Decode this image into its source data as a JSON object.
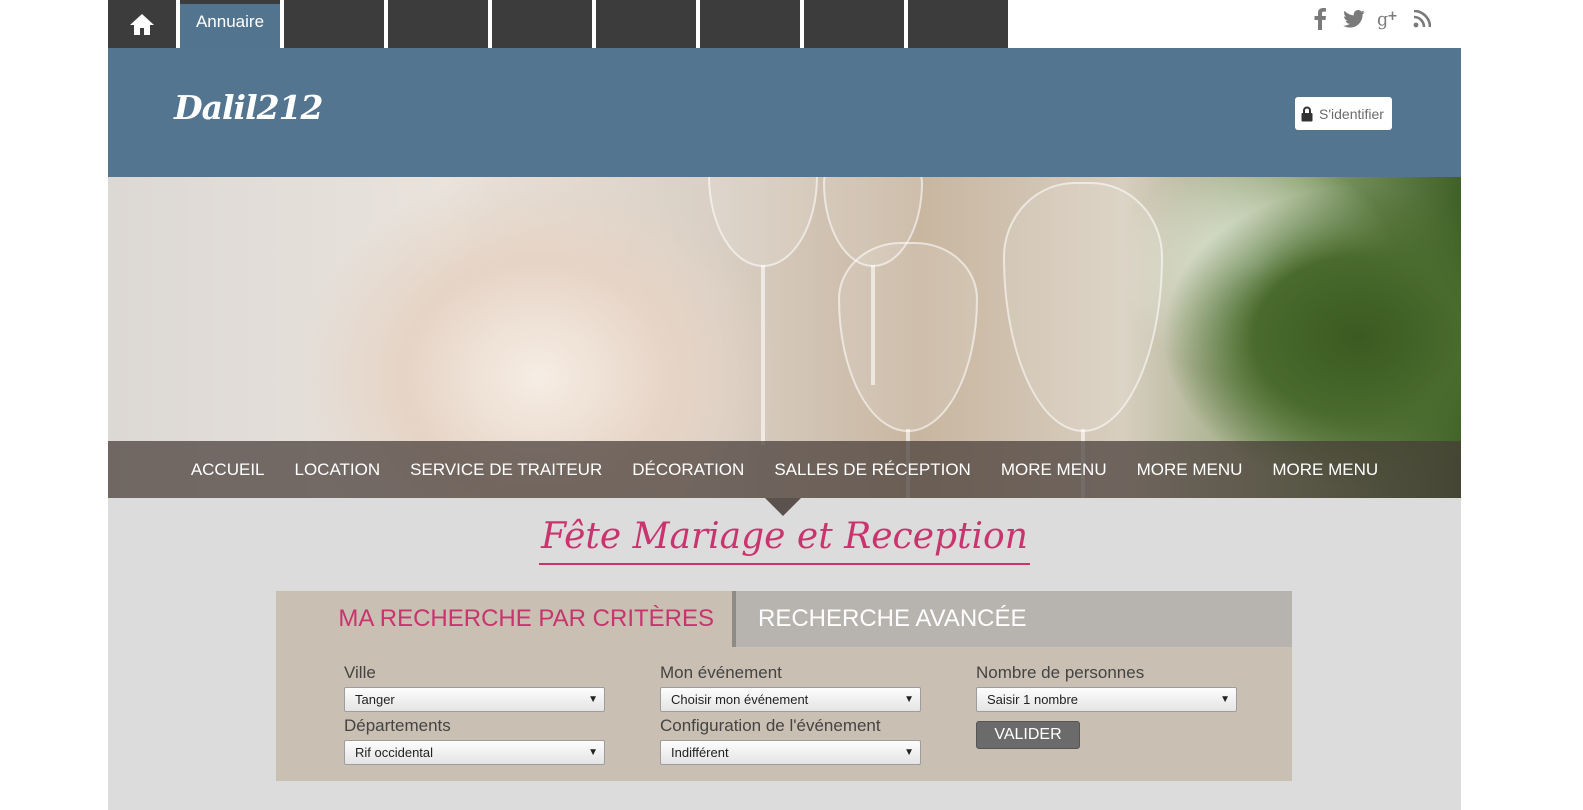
{
  "topbar": {
    "home_icon": "home-icon",
    "active_tab": "Annuaire",
    "empty_tabs": 7,
    "social_icons": [
      "facebook-icon",
      "twitter-icon",
      "google-plus-icon",
      "rss-icon"
    ]
  },
  "header": {
    "logo": "Dalil212",
    "login_label": "S'identifier",
    "login_icon": "lock-icon",
    "background_color": "#54758f"
  },
  "main_nav": {
    "items": [
      {
        "label": "ACCUEIL"
      },
      {
        "label": "LOCATION"
      },
      {
        "label": "SERVICE DE TRAITEUR"
      },
      {
        "label": "DÉCORATION"
      },
      {
        "label": "SALLES DE RÉCEPTION"
      },
      {
        "label": "MORE MENU"
      },
      {
        "label": "MORE MENU"
      },
      {
        "label": "MORE MENU"
      }
    ]
  },
  "tagline": "Fête Mariage et Reception",
  "search": {
    "tab_active": "MA RECHERCHE PAR CRITÈRES",
    "tab_inactive": "RECHERCHE AVANCÉE",
    "fields": {
      "ville": {
        "label": "Ville",
        "value": "Tanger"
      },
      "departements": {
        "label": "Départements",
        "value": "Rif occidental"
      },
      "evenement": {
        "label": "Mon événement",
        "value": "Choisir mon événement"
      },
      "configuration": {
        "label": "Configuration de l'événement",
        "value": "Indifférent"
      },
      "personnes": {
        "label": "Nombre de personnes",
        "value": "Saisir 1 nombre"
      }
    },
    "submit_label": "VALIDER"
  },
  "colors": {
    "accent_pink": "#c9346f",
    "dark_tab": "#3c3c3c",
    "search_panel": "#c9bfb2"
  }
}
